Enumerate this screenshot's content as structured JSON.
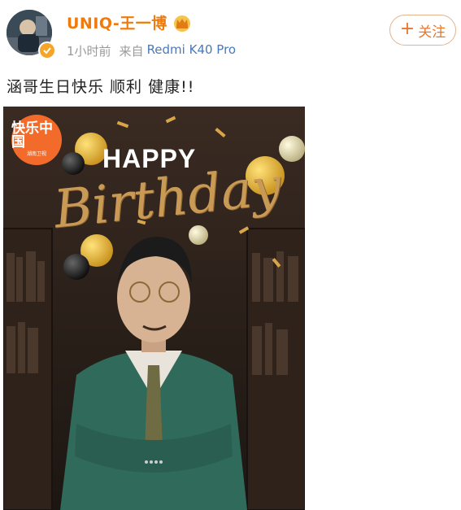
{
  "post": {
    "username": "UNIQ-王一博",
    "time": "1小时前",
    "source_prefix": "来自",
    "device": "Redmi K40 Pro",
    "follow_label": "关注",
    "text": "涵哥生日快乐 顺利 健康!!"
  },
  "poster": {
    "logo_text": "快乐中国",
    "logo_sub": "湖南卫视",
    "happy": "HAPPY",
    "birthday": "Birthday"
  },
  "colors": {
    "username": "#f07b0c",
    "device_link": "#4a79b8",
    "follow_button": "#e8772a",
    "verified_badge": "#f4a52a"
  },
  "icons": [
    "avatar",
    "verified-badge-icon",
    "crown-icon",
    "plus-icon"
  ]
}
